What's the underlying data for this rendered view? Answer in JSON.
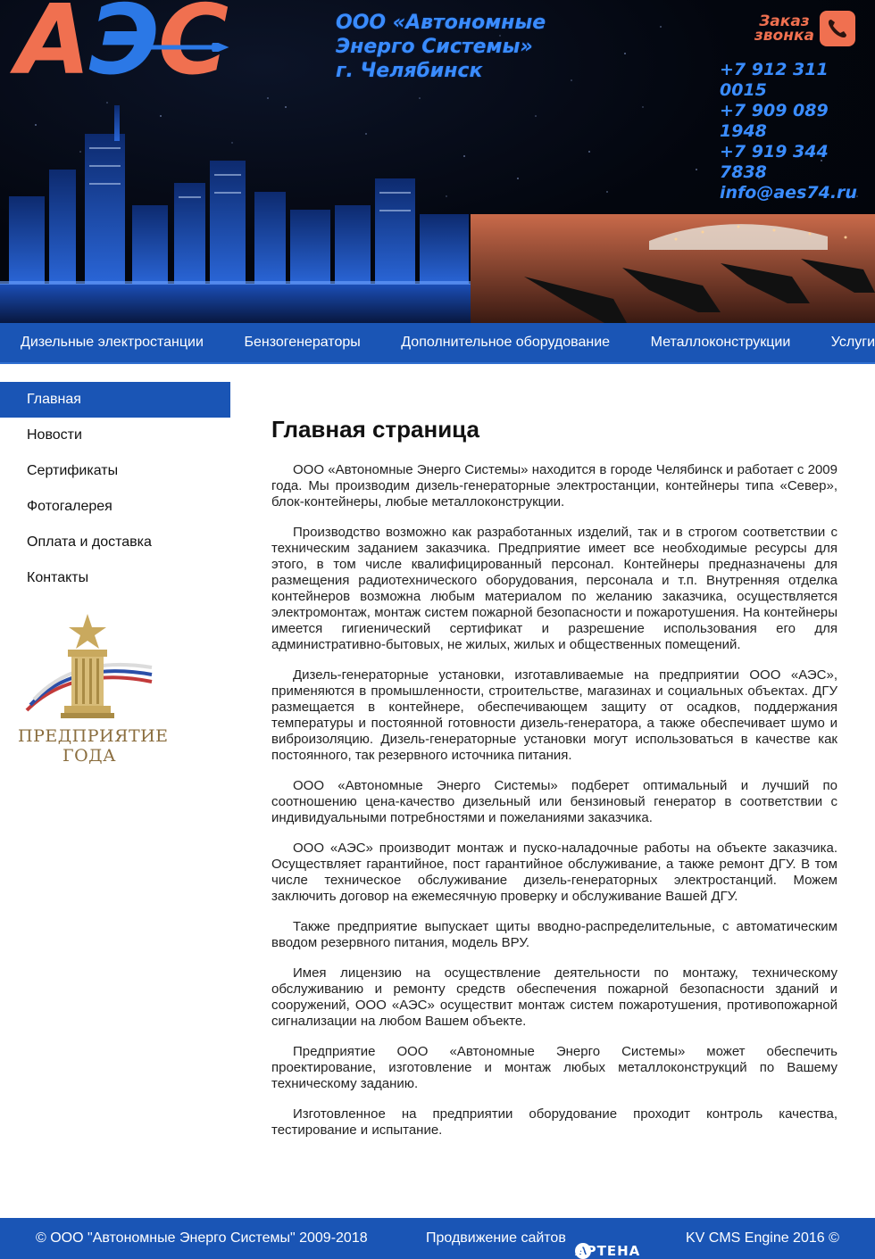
{
  "header": {
    "logo_letters": [
      "А",
      "Э",
      "С"
    ],
    "company_lines": [
      "ООО «Автономные",
      "Энерго Системы»",
      "г. Челябинск"
    ],
    "callback_label_1": "Заказ",
    "callback_label_2": "звонка",
    "phones": [
      "+7 912 311 0015",
      "+7 909 089 1948",
      "+7 919 344 7838"
    ],
    "email": "info@aes74.ru",
    "colors": {
      "logo_orange": "#f07050",
      "logo_blue": "#2b78e6",
      "accent": "#1a55b5"
    }
  },
  "topnav": {
    "items": [
      "Дизельные электростанции",
      "Бензогенераторы",
      "Дополнительное оборудование",
      "Металлоконструкции",
      "Услуги"
    ]
  },
  "sidebar": {
    "items": [
      {
        "label": "Главная",
        "active": true
      },
      {
        "label": "Новости",
        "active": false
      },
      {
        "label": "Сертификаты",
        "active": false
      },
      {
        "label": "Фотогалерея",
        "active": false
      },
      {
        "label": "Оплата и доставка",
        "active": false
      },
      {
        "label": "Контакты",
        "active": false
      }
    ],
    "award_line_1": "ПРЕДПРИЯТИЕ",
    "award_line_2": "ГОДА"
  },
  "main": {
    "title": "Главная страница",
    "paragraphs": [
      "ООО «Автономные Энерго Системы» находится в городе Челябинск и работает с 2009 года. Мы производим дизель-генераторные электростанции, контейнеры типа «Север», блок-контейнеры, любые металлоконструкции.",
      "Производство возможно как разработанных изделий, так и в строгом соответствии с техническим заданием заказчика. Предприятие имеет все необходимые ресурсы для этого, в том числе квалифицированный персонал. Контейнеры предназначены для размещения радиотехнического оборудования, персонала и т.п. Внутренняя отделка контейнеров возможна любым материалом по желанию заказчика, осуществляется электромонтаж, монтаж систем пожарной безопасности и пожаротушения. На контейнеры имеется гигиенический сертификат и разрешение использования его для административно-бытовых, не жилых, жилых и общественных помещений.",
      "Дизель-генераторные установки, изготавливаемые на предприятии ООО «АЭС», применяются в промышленности, строительстве, магазинах и социальных объектах. ДГУ размещается в контейнере, обеспечивающем защиту от осадков, поддержания температуры и постоянной готовности дизель-генератора, а также обеспечивает шумо и виброизоляцию. Дизель-генераторные установки могут использоваться в качестве как постоянного, так резервного источника питания.",
      "ООО «Автономные Энерго Системы» подберет оптимальный и лучший по соотношению цена-качество дизельный или бензиновый генератор в соответствии с индивидуальными потребностями и пожеланиями заказчика.",
      "ООО «АЭС» производит монтаж и пуско-наладочные работы на объекте заказчика. Осуществляет гарантийное, пост гарантийное обслуживание, а также ремонт ДГУ. В том числе техническое обслуживание дизель-генераторных электростанций. Можем заключить договор на ежемесячную проверку и обслуживание Вашей ДГУ.",
      "Также предприятие выпускает щиты вводно-распределительные, с автоматическим вводом резервного питания, модель ВРУ.",
      "Имея лицензию на осуществление деятельности по монтажу, техническому обслуживанию и ремонту средств обеспечения пожарной безопасности зданий и сооружений, ООО «АЭС» осуществит монтаж систем пожаротушения, противопожарной сигнализации на любом Вашем объекте.",
      "Предприятие ООО «Автономные Энерго Системы» может обеспечить проектирование, изготовление и монтаж любых металлоконструкций по Вашему техническому заданию.",
      "Изготовленное на предприятии оборудование проходит контроль качества, тестирование и испытание."
    ]
  },
  "footer": {
    "copyright": "© ООО \"Автономные Энерго Системы\" 2009-2018",
    "promo_label": "Продвижение сайтов",
    "promo_brand": "АРТЕНА",
    "promo_badge": "А",
    "engine": "KV CMS Engine 2016 ©"
  }
}
